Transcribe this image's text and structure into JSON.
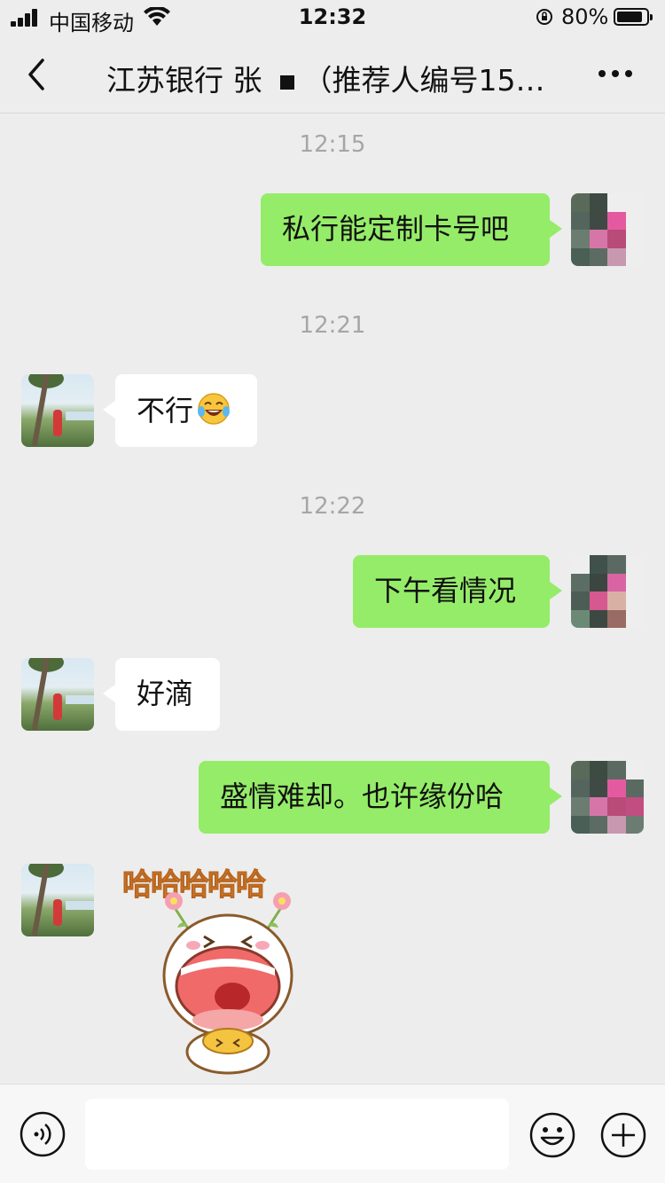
{
  "status_bar": {
    "carrier": "中国移动",
    "time": "12:32",
    "battery_percent": "80%",
    "battery_level": 0.8
  },
  "header": {
    "title_part1": "江苏银行 张",
    "title_part2": "（推荐人编号15…",
    "back_icon": "chevron-left-icon",
    "more_icon": "more-dots-icon"
  },
  "messages": {
    "time_1": "12:15",
    "msg_1": "私行能定制卡号吧",
    "time_2": "12:21",
    "msg_2": "不行",
    "time_3": "12:22",
    "msg_3": "下午看情况",
    "msg_4": "好滴",
    "msg_5": "盛情难却。也许缘份哈",
    "sticker_text": "哈哈哈哈哈"
  },
  "input_bar": {
    "voice_icon": "voice-icon",
    "emoji_icon": "emoji-icon",
    "plus_icon": "plus-icon",
    "placeholder": ""
  },
  "colors": {
    "my_bubble": "#95ec69",
    "their_bubble": "#ffffff",
    "background": "#ededed"
  }
}
